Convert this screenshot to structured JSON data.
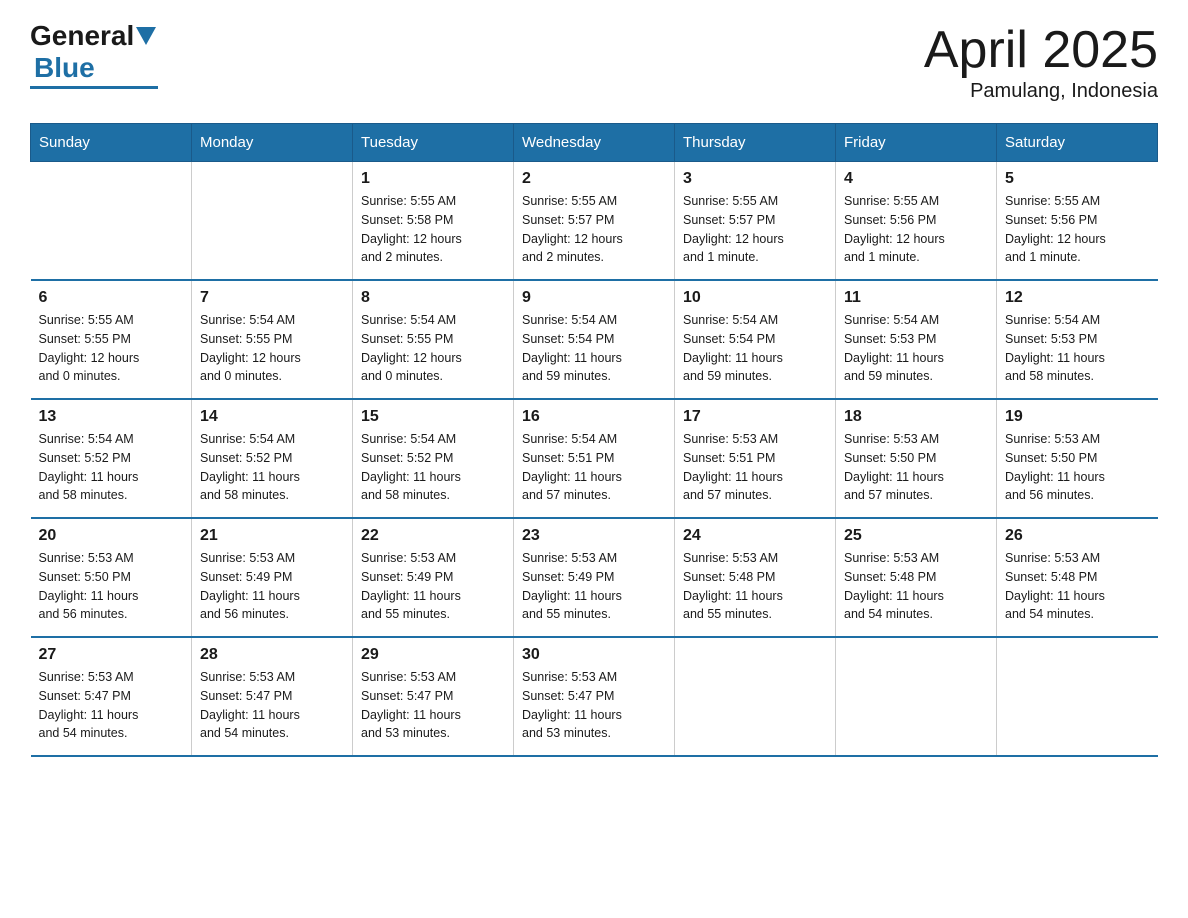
{
  "logo": {
    "general": "General",
    "blue": "Blue"
  },
  "title": {
    "month": "April 2025",
    "location": "Pamulang, Indonesia"
  },
  "weekdays": [
    "Sunday",
    "Monday",
    "Tuesday",
    "Wednesday",
    "Thursday",
    "Friday",
    "Saturday"
  ],
  "weeks": [
    [
      {
        "day": "",
        "info": ""
      },
      {
        "day": "",
        "info": ""
      },
      {
        "day": "1",
        "info": "Sunrise: 5:55 AM\nSunset: 5:58 PM\nDaylight: 12 hours\nand 2 minutes."
      },
      {
        "day": "2",
        "info": "Sunrise: 5:55 AM\nSunset: 5:57 PM\nDaylight: 12 hours\nand 2 minutes."
      },
      {
        "day": "3",
        "info": "Sunrise: 5:55 AM\nSunset: 5:57 PM\nDaylight: 12 hours\nand 1 minute."
      },
      {
        "day": "4",
        "info": "Sunrise: 5:55 AM\nSunset: 5:56 PM\nDaylight: 12 hours\nand 1 minute."
      },
      {
        "day": "5",
        "info": "Sunrise: 5:55 AM\nSunset: 5:56 PM\nDaylight: 12 hours\nand 1 minute."
      }
    ],
    [
      {
        "day": "6",
        "info": "Sunrise: 5:55 AM\nSunset: 5:55 PM\nDaylight: 12 hours\nand 0 minutes."
      },
      {
        "day": "7",
        "info": "Sunrise: 5:54 AM\nSunset: 5:55 PM\nDaylight: 12 hours\nand 0 minutes."
      },
      {
        "day": "8",
        "info": "Sunrise: 5:54 AM\nSunset: 5:55 PM\nDaylight: 12 hours\nand 0 minutes."
      },
      {
        "day": "9",
        "info": "Sunrise: 5:54 AM\nSunset: 5:54 PM\nDaylight: 11 hours\nand 59 minutes."
      },
      {
        "day": "10",
        "info": "Sunrise: 5:54 AM\nSunset: 5:54 PM\nDaylight: 11 hours\nand 59 minutes."
      },
      {
        "day": "11",
        "info": "Sunrise: 5:54 AM\nSunset: 5:53 PM\nDaylight: 11 hours\nand 59 minutes."
      },
      {
        "day": "12",
        "info": "Sunrise: 5:54 AM\nSunset: 5:53 PM\nDaylight: 11 hours\nand 58 minutes."
      }
    ],
    [
      {
        "day": "13",
        "info": "Sunrise: 5:54 AM\nSunset: 5:52 PM\nDaylight: 11 hours\nand 58 minutes."
      },
      {
        "day": "14",
        "info": "Sunrise: 5:54 AM\nSunset: 5:52 PM\nDaylight: 11 hours\nand 58 minutes."
      },
      {
        "day": "15",
        "info": "Sunrise: 5:54 AM\nSunset: 5:52 PM\nDaylight: 11 hours\nand 58 minutes."
      },
      {
        "day": "16",
        "info": "Sunrise: 5:54 AM\nSunset: 5:51 PM\nDaylight: 11 hours\nand 57 minutes."
      },
      {
        "day": "17",
        "info": "Sunrise: 5:53 AM\nSunset: 5:51 PM\nDaylight: 11 hours\nand 57 minutes."
      },
      {
        "day": "18",
        "info": "Sunrise: 5:53 AM\nSunset: 5:50 PM\nDaylight: 11 hours\nand 57 minutes."
      },
      {
        "day": "19",
        "info": "Sunrise: 5:53 AM\nSunset: 5:50 PM\nDaylight: 11 hours\nand 56 minutes."
      }
    ],
    [
      {
        "day": "20",
        "info": "Sunrise: 5:53 AM\nSunset: 5:50 PM\nDaylight: 11 hours\nand 56 minutes."
      },
      {
        "day": "21",
        "info": "Sunrise: 5:53 AM\nSunset: 5:49 PM\nDaylight: 11 hours\nand 56 minutes."
      },
      {
        "day": "22",
        "info": "Sunrise: 5:53 AM\nSunset: 5:49 PM\nDaylight: 11 hours\nand 55 minutes."
      },
      {
        "day": "23",
        "info": "Sunrise: 5:53 AM\nSunset: 5:49 PM\nDaylight: 11 hours\nand 55 minutes."
      },
      {
        "day": "24",
        "info": "Sunrise: 5:53 AM\nSunset: 5:48 PM\nDaylight: 11 hours\nand 55 minutes."
      },
      {
        "day": "25",
        "info": "Sunrise: 5:53 AM\nSunset: 5:48 PM\nDaylight: 11 hours\nand 54 minutes."
      },
      {
        "day": "26",
        "info": "Sunrise: 5:53 AM\nSunset: 5:48 PM\nDaylight: 11 hours\nand 54 minutes."
      }
    ],
    [
      {
        "day": "27",
        "info": "Sunrise: 5:53 AM\nSunset: 5:47 PM\nDaylight: 11 hours\nand 54 minutes."
      },
      {
        "day": "28",
        "info": "Sunrise: 5:53 AM\nSunset: 5:47 PM\nDaylight: 11 hours\nand 54 minutes."
      },
      {
        "day": "29",
        "info": "Sunrise: 5:53 AM\nSunset: 5:47 PM\nDaylight: 11 hours\nand 53 minutes."
      },
      {
        "day": "30",
        "info": "Sunrise: 5:53 AM\nSunset: 5:47 PM\nDaylight: 11 hours\nand 53 minutes."
      },
      {
        "day": "",
        "info": ""
      },
      {
        "day": "",
        "info": ""
      },
      {
        "day": "",
        "info": ""
      }
    ]
  ]
}
